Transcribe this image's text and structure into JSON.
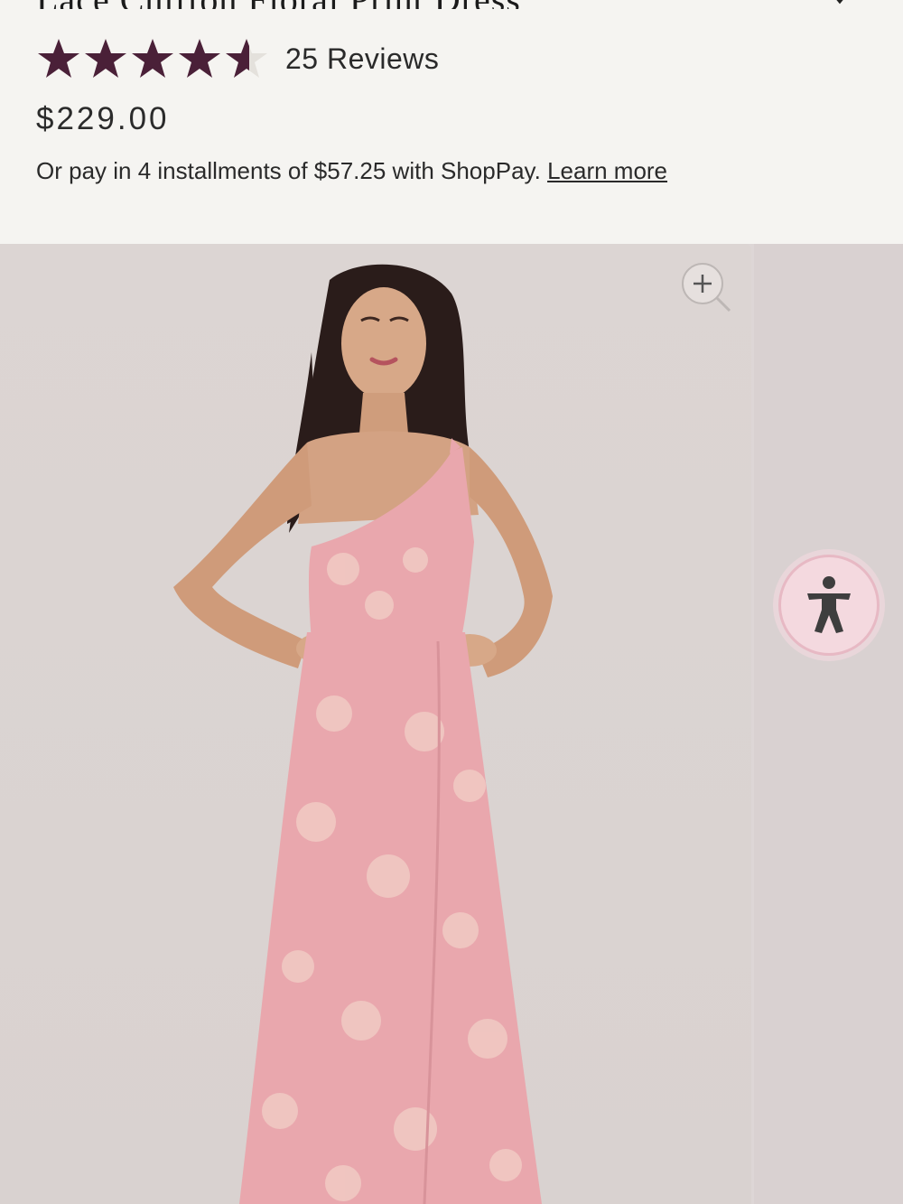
{
  "product": {
    "title": "Lace Chiffon Floral Print Dress",
    "rating": 4.5,
    "rating_max": 5,
    "reviews_label": "25 Reviews",
    "price": "$229.00",
    "installment_text": "Or pay in 4 installments of $57.25 with ShopPay.",
    "learn_more_label": "Learn more"
  },
  "colors": {
    "star": "#4a2038",
    "page_bg": "#f5f4f1",
    "dress": "#e9a7ad",
    "accessibility_bg": "#f4d9df"
  },
  "icons": {
    "zoom": "zoom-in-icon",
    "accessibility": "accessibility-icon",
    "header_toggle": "chevron-down-icon",
    "star": "star-icon"
  }
}
